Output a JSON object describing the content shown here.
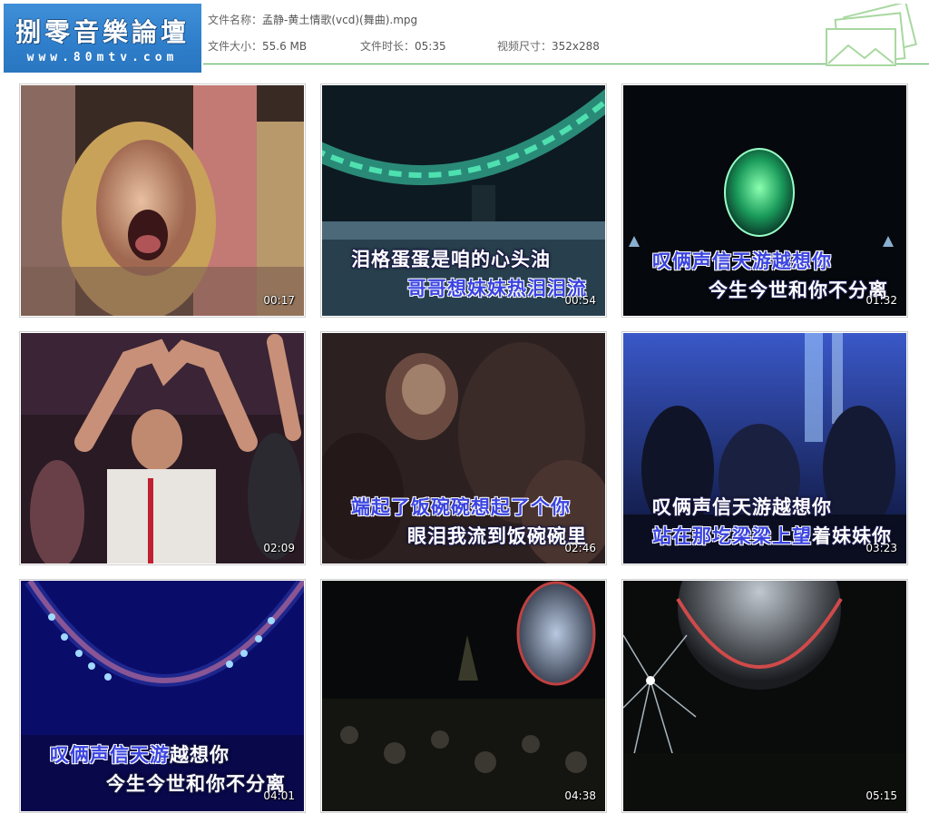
{
  "logo": {
    "title": "捌零音樂論壇",
    "url": "www.80mtv.com"
  },
  "file_info": {
    "name_label": "文件名称：",
    "name_value": "孟静-黄土情歌(vcd)(舞曲).mpg",
    "size_label": "文件大小：",
    "size_value": "55.6 MB",
    "duration_label": "文件时长：",
    "duration_value": "05:35",
    "dimension_label": "视频尺寸：",
    "dimension_value": "352x288"
  },
  "colors": {
    "accent_green": "#4caf50",
    "logo_blue": "#2f7fcc",
    "lyric_highlight": "#3b44e0"
  },
  "thumbnails": [
    {
      "timestamp": "00:17",
      "scene": "crowd-closeup-singing",
      "lyrics": []
    },
    {
      "timestamp": "00:54",
      "scene": "stage-arc-green-lights",
      "lyrics": [
        {
          "plain": "泪格蛋蛋是咱的心头油",
          "highlight": ""
        },
        {
          "plain": "",
          "highlight": "哥哥想妹妹热泪泪流"
        }
      ]
    },
    {
      "timestamp": "01:32",
      "scene": "dark-stage-green-globe",
      "lyrics": [
        {
          "plain": "",
          "highlight": "叹俩声信天游越想你"
        },
        {
          "plain": "今生今世和你不分离",
          "highlight": ""
        }
      ]
    },
    {
      "timestamp": "02:09",
      "scene": "crowd-heart-hands",
      "lyrics": []
    },
    {
      "timestamp": "02:46",
      "scene": "dim-crowd-dancing",
      "lyrics": [
        {
          "plain": "",
          "highlight": "端起了饭碗碗想起了个你"
        },
        {
          "plain": "眼泪我流到饭碗碗里",
          "highlight": ""
        }
      ]
    },
    {
      "timestamp": "03:23",
      "scene": "blue-concert-crowd",
      "lyrics": [
        {
          "plain": "叹俩声信天游越想你",
          "highlight": ""
        },
        {
          "highlight_prefix": "站在那圪梁梁上望",
          "plain": "着妹妹你"
        }
      ]
    },
    {
      "timestamp": "04:01",
      "scene": "blue-stage-arc-lights",
      "lyrics": [
        {
          "highlight_prefix": "叹俩声信天游",
          "plain": "越想你"
        },
        {
          "plain": "今生今世和你不分离",
          "highlight": ""
        }
      ]
    },
    {
      "timestamp": "04:38",
      "scene": "night-crowd-sphere",
      "lyrics": []
    },
    {
      "timestamp": "05:15",
      "scene": "stage-sphere-light-beams",
      "lyrics": []
    }
  ]
}
